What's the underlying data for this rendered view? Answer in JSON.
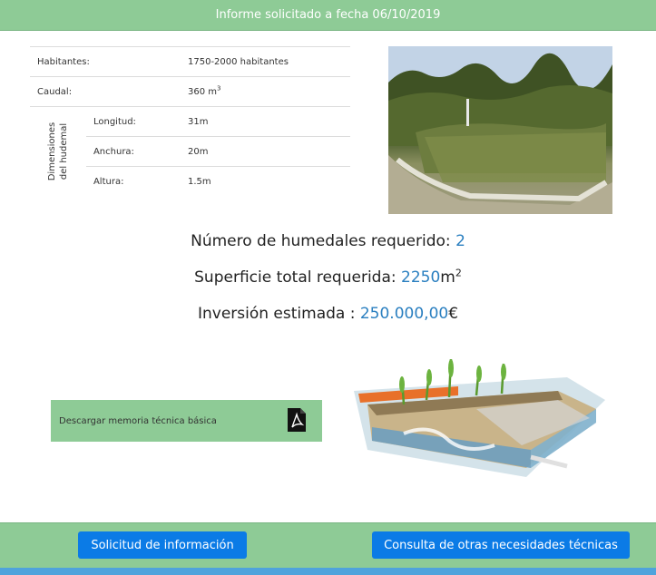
{
  "header": {
    "title": "Informe solicitado a fecha 06/10/2019"
  },
  "specs": {
    "habitantes": {
      "label": "Habitantes:",
      "value": "1750-2000 habitantes"
    },
    "caudal": {
      "label": "Caudal:",
      "value": "360 m",
      "value_sup": "3"
    },
    "dimensions_group": {
      "line1": "Dimensiones",
      "line2": "del hudemal"
    },
    "longitud": {
      "label": "Longitud:",
      "value": "31m"
    },
    "anchura": {
      "label": "Anchura:",
      "value": "20m"
    },
    "altura": {
      "label": "Altura:",
      "value": "1.5m"
    }
  },
  "summary": {
    "humedales": {
      "label": "Número de humedales requerido: ",
      "value": "2"
    },
    "superficie": {
      "label": "Superficie total requerida: ",
      "value": "2250",
      "unit": "m",
      "unit_sup": "2"
    },
    "inversion": {
      "label": "Inversión estimada : ",
      "value": "250.000,00",
      "currency": "€"
    }
  },
  "download": {
    "label": "Descargar memoria técnica básica",
    "icon": "pdf-icon"
  },
  "footer": {
    "solicitud_label": "Solicitud de información",
    "consulta_label": "Consulta de otras necesidades técnicas"
  },
  "colors": {
    "green": "#8ecb96",
    "blue_button": "#0b7be6",
    "accent_value": "#2a7fc0",
    "stripe": "#4fa3dc"
  }
}
